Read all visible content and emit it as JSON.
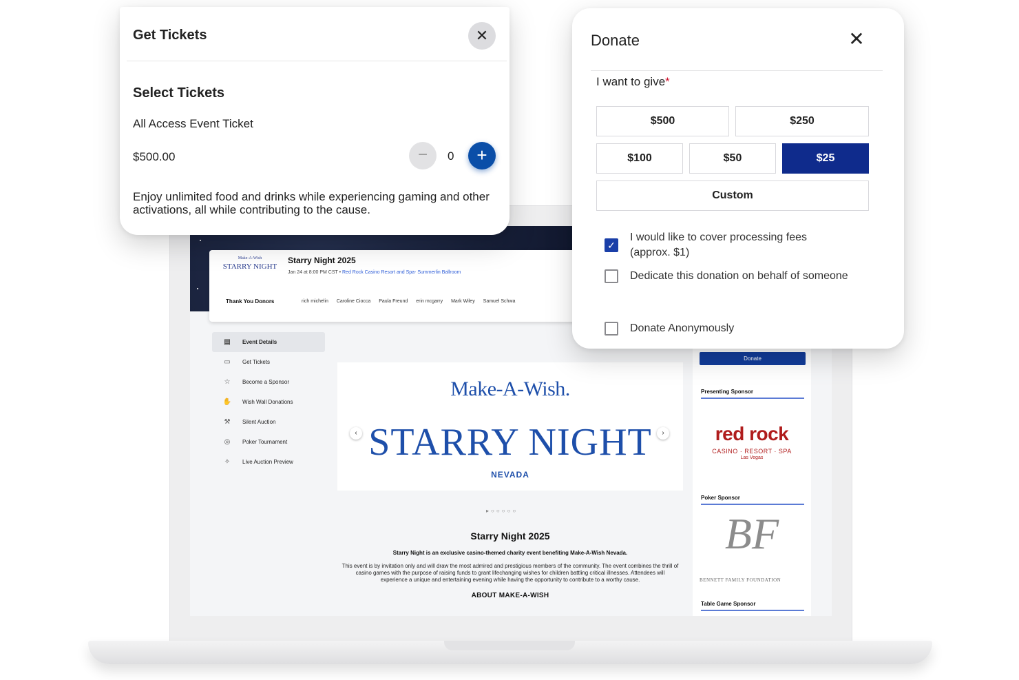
{
  "tickets_modal": {
    "title": "Get Tickets",
    "close_icon": "close-icon",
    "section_title": "Select Tickets",
    "ticket_name": "All Access Event Ticket",
    "price": "$500.00",
    "quantity": "0",
    "minus_symbol": "−",
    "plus_symbol": "+",
    "description": "Enjoy unlimited food and drinks while experiencing gaming and other activations, all while contributing to the cause."
  },
  "donate_modal": {
    "title": "Donate",
    "close_symbol": "✕",
    "give_label": "I want to give",
    "required_mark": "*",
    "amounts": [
      "$500",
      "$250",
      "$100",
      "$50",
      "$25",
      "Custom"
    ],
    "selected_amount": "$25",
    "options": [
      {
        "label": "I would like to cover processing fees (approx. $1)",
        "checked": true
      },
      {
        "label": "Dedicate this donation on behalf of someone",
        "checked": false
      },
      {
        "label": "Donate Anonymously",
        "checked": false
      }
    ],
    "accent_color": "#0f2b8c"
  },
  "event_page": {
    "mini_logo_top": "Make-A-Wish",
    "mini_logo_main": "STARRY NIGHT",
    "title": "Starry Night 2025",
    "date": "Jan 24 at 8:00 PM CST",
    "separator": "•",
    "venue": "Red Rock Casino Resort and Spa- Summerlin Ballroom",
    "donors_label": "Thank You Donors",
    "donors": [
      "rich michelin",
      "Caroline Ciocca",
      "Paula Freund",
      "erin mcgarry",
      "Mark Wiley",
      "Samuel Schwa"
    ],
    "nav": [
      {
        "label": "Event Details",
        "icon": "calendar-icon",
        "glyph": "▤"
      },
      {
        "label": "Get Tickets",
        "icon": "ticket-icon",
        "glyph": "▭"
      },
      {
        "label": "Become a Sponsor",
        "icon": "star-icon",
        "glyph": "☆"
      },
      {
        "label": "Wish Wall Donations",
        "icon": "donation-hand-icon",
        "glyph": "✋"
      },
      {
        "label": "Silent Auction",
        "icon": "gavel-icon",
        "glyph": "⚒"
      },
      {
        "label": "Poker Tournament",
        "icon": "poker-chip-icon",
        "glyph": "◎"
      },
      {
        "label": "Live Auction Preview",
        "icon": "auction-preview-icon",
        "glyph": "✧"
      }
    ],
    "hero": {
      "brand": "Make-A-Wish.",
      "headline": "STARRY NIGHT",
      "sub": "NEVADA",
      "prev": "‹",
      "next": "›",
      "dots": "▸○○○○○"
    },
    "desc_title": "Starry Night 2025",
    "desc_bold": "Starry Night is an exclusive casino-themed charity event benefiting Make-A-Wish Nevada.",
    "desc_body": "This event is by invitation only and will draw the most admired and prestigious members of the community. The event combines the thrill of casino games with the purpose of raising funds to grant lifechanging wishes for children battling critical illnesses. Attendees will experience a unique and entertaining evening while having the opportunity to contribute to a worthy cause.",
    "about": "ABOUT MAKE-A-WISH",
    "donate_button": "Donate",
    "sponsors": [
      {
        "tier": "Presenting Sponsor",
        "logo_main": "red rock",
        "logo_sub": "CASINO · RESORT · SPA",
        "logo_sub2": "Las Vegas"
      },
      {
        "tier": "Poker Sponsor",
        "logo_main": "BF",
        "logo_sub": "BENNETT FAMILY FOUNDATION"
      },
      {
        "tier": "Table Game Sponsor"
      }
    ]
  }
}
